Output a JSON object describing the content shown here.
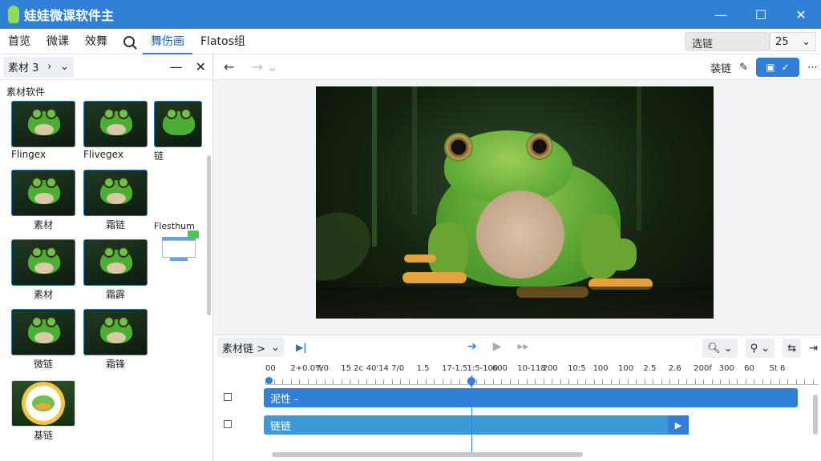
{
  "window": {
    "title": "娃娃微课软件主",
    "minimize": "—",
    "maximize": "☐",
    "close": "✕"
  },
  "menu": {
    "items": [
      "首览",
      "微课",
      "效舞",
      "舞伤画",
      "Flatos组"
    ],
    "search_value": "选链",
    "zoom_value": "25"
  },
  "left_panel": {
    "dropdown": "素材 3",
    "section": "素材软件",
    "thumbs": [
      {
        "label": "Flingex"
      },
      {
        "label": "Flivegex"
      },
      {
        "label": "链"
      },
      {
        "label": "素材"
      },
      {
        "label": "霜链"
      },
      {
        "label": "Flesthum"
      },
      {
        "label": "素材"
      },
      {
        "label": "霜霹"
      },
      {
        "label": "微链"
      },
      {
        "label": "霜锋"
      },
      {
        "label": "基链"
      }
    ]
  },
  "toolbar": {
    "label": "装链"
  },
  "timeline": {
    "dropdown": "素材链 >",
    "tick_labels": [
      "00",
      "2+0.0%",
      "7/0",
      "15 2c",
      "40'14",
      "7/0",
      "1.5",
      "17-1.5",
      "1:5-100",
      "600",
      "10-118",
      "200",
      "10:5",
      "100",
      "100",
      "2.5",
      "2.6",
      "200f",
      "300",
      "60",
      "St 6"
    ],
    "tracks": [
      {
        "name": "泥性 -"
      },
      {
        "name": "链链"
      }
    ]
  }
}
